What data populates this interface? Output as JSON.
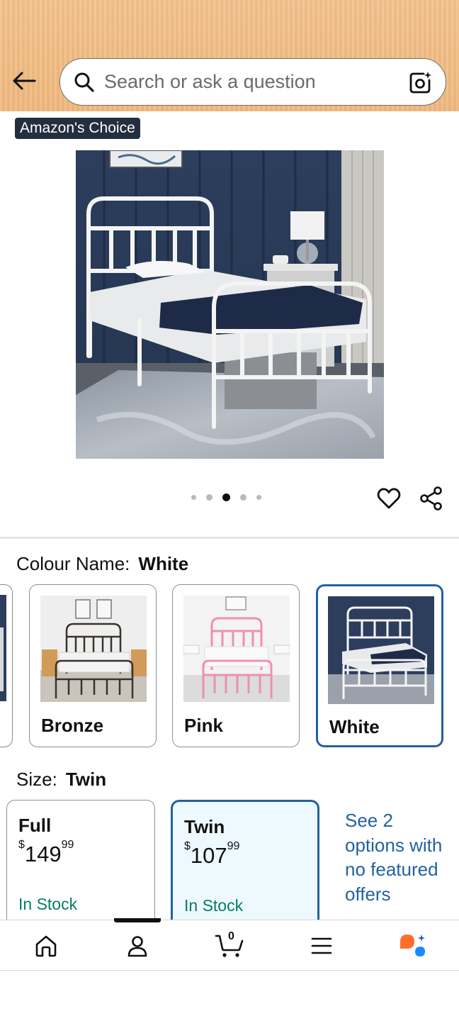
{
  "search": {
    "placeholder": "Search or ask a question"
  },
  "badge": {
    "label": "Amazon's Choice"
  },
  "gallery": {
    "image_count": 5,
    "active_index": 2
  },
  "colour": {
    "label": "Colour Name:",
    "selected": "White",
    "options": [
      {
        "name": "Bronze"
      },
      {
        "name": "Pink"
      },
      {
        "name": "White"
      }
    ]
  },
  "size": {
    "label": "Size:",
    "selected": "Twin",
    "options": [
      {
        "name": "Full",
        "currency": "$",
        "price_whole": "149",
        "price_fraction": "99",
        "stock": "In Stock"
      },
      {
        "name": "Twin",
        "currency": "$",
        "price_whole": "107",
        "price_fraction": "99",
        "stock": "In Stock"
      }
    ],
    "see_more": "See 2 options with no featured offers"
  },
  "nav": {
    "cart_count": "0",
    "items": [
      "home-icon",
      "account-icon",
      "cart-icon",
      "menu-icon",
      "rufus-icon"
    ]
  },
  "colors": {
    "header": "#f0bb82",
    "accent_blue": "#2162a1",
    "in_stock_green": "#067d62",
    "rufus_orange": "#ff6f2c",
    "rufus_blue": "#1a8cff"
  }
}
